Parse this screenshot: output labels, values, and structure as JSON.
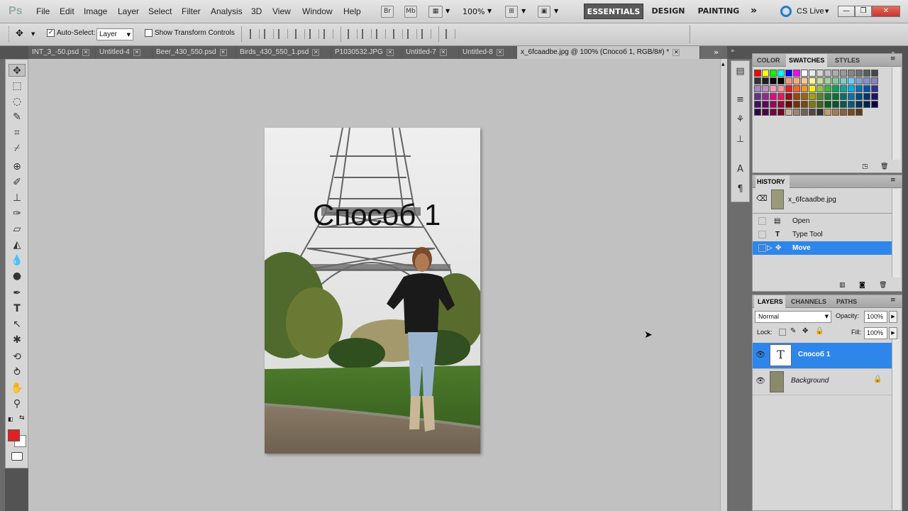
{
  "app": {
    "logo": "Ps"
  },
  "menu": [
    "File",
    "Edit",
    "Image",
    "Layer",
    "Select",
    "Filter",
    "Analysis",
    "3D",
    "View",
    "Window",
    "Help"
  ],
  "menubar_tools": {
    "bridge": "Br",
    "minibridge": "Mb",
    "zoom": "100%"
  },
  "workspaces": [
    "ESSENTIALS",
    "DESIGN",
    "PAINTING"
  ],
  "cslive": "CS Live",
  "options": {
    "auto_select_label": "Auto-Select:",
    "auto_select_value": "Layer",
    "show_transform_label": "Show Transform Controls"
  },
  "tabs": [
    {
      "label": "INT_3_-50.psd"
    },
    {
      "label": "Untitled-4"
    },
    {
      "label": "Beer_430_550.psd"
    },
    {
      "label": "Birds_430_550_1.psd"
    },
    {
      "label": "P1030532.JPG"
    },
    {
      "label": "Untitled-7"
    },
    {
      "label": "Untitled-8"
    },
    {
      "label": "x_6fcaadbe.jpg @ 100% (Способ 1, RGB/8#) *"
    }
  ],
  "document": {
    "text_layer": "Способ 1"
  },
  "colors": {
    "foreground": "#e32020",
    "background": "#ffffff",
    "selection": "#2f86ea"
  },
  "panels": {
    "swatch_tabs": [
      "COLOR",
      "SWATCHES",
      "STYLES"
    ],
    "history": {
      "tab": "HISTORY",
      "snapshot": "x_6fcaadbe.jpg",
      "steps": [
        "Open",
        "Type Tool",
        "Move"
      ]
    },
    "layers": {
      "tabs": [
        "LAYERS",
        "CHANNELS",
        "PATHS"
      ],
      "blend_mode": "Normal",
      "opacity_label": "Opacity:",
      "opacity": "100%",
      "lock_label": "Lock:",
      "fill_label": "Fill:",
      "fill": "100%",
      "items": [
        "Способ 1",
        "Background"
      ]
    }
  }
}
